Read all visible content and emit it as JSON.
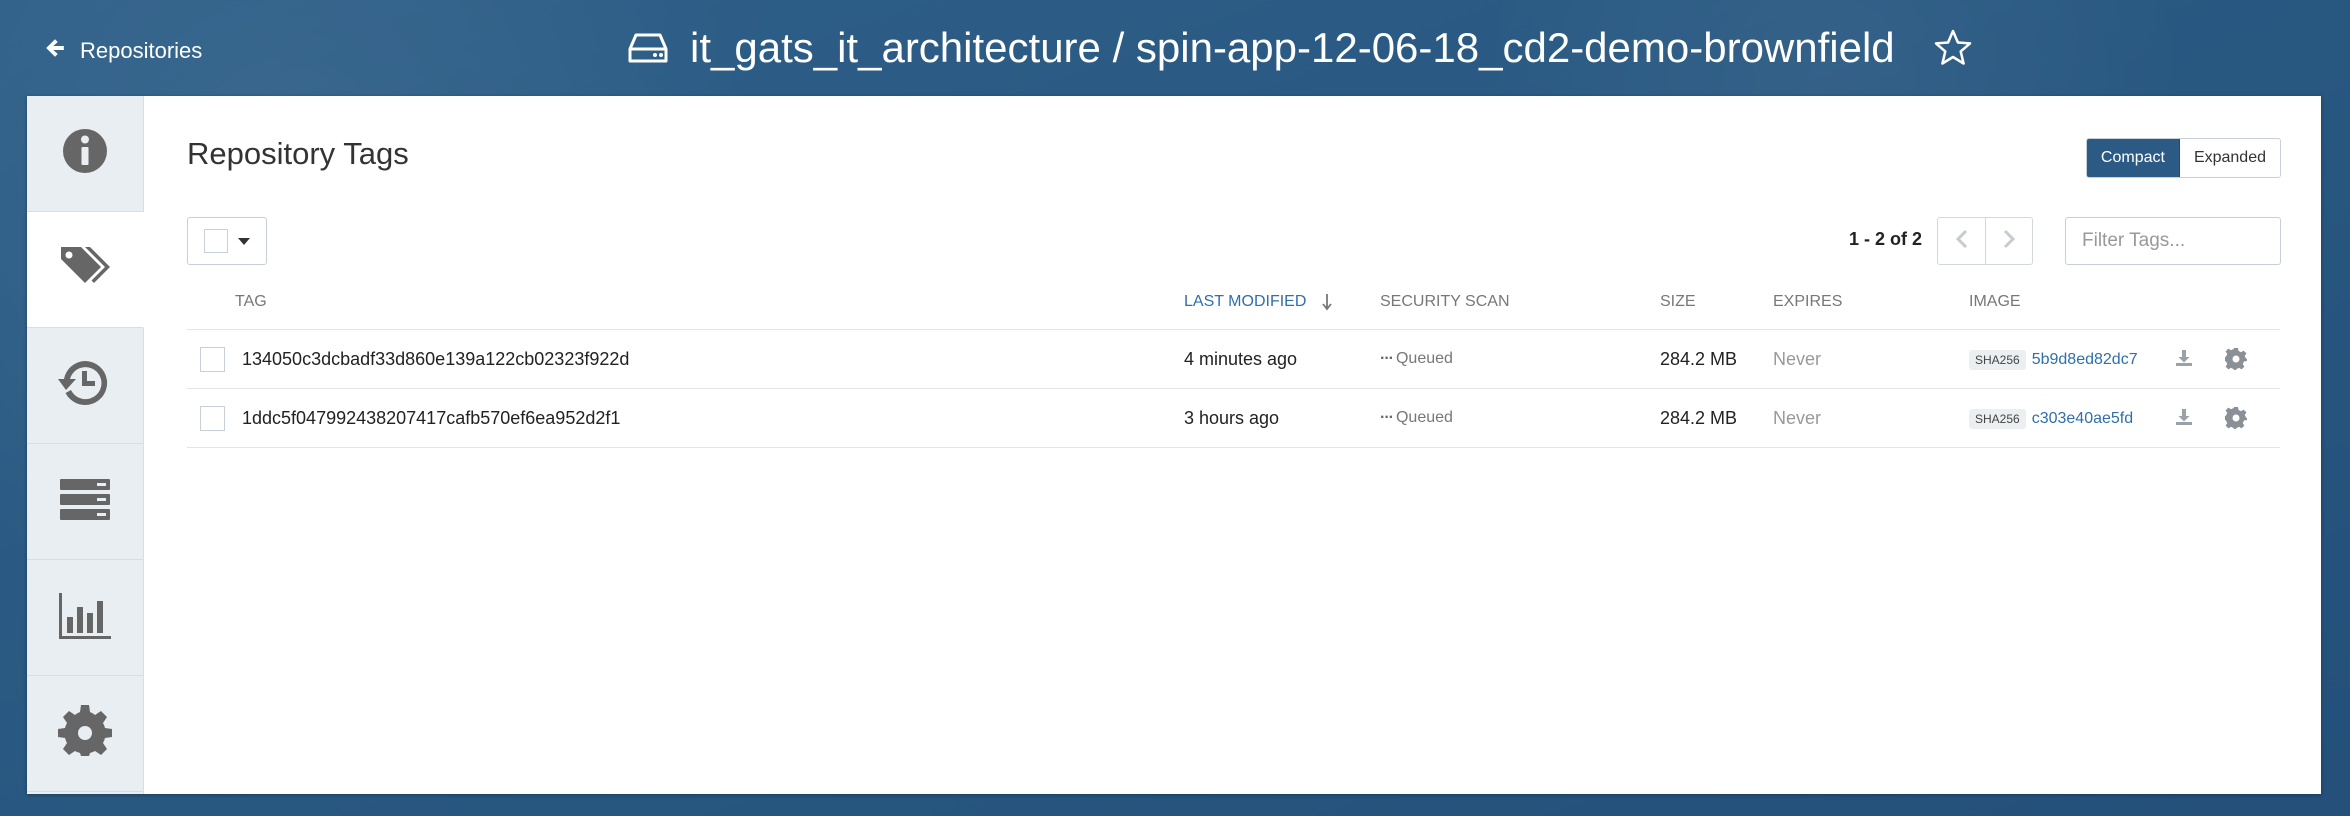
{
  "header": {
    "back_label": "Repositories",
    "repo_title": "it_gats_it_architecture / spin-app-12-06-18_cd2-demo-brownfield",
    "icons": {
      "back": "arrow-left-icon",
      "repo": "hard-drive-icon",
      "star": "star-outline-icon"
    }
  },
  "sidebar": {
    "items": [
      {
        "name": "info",
        "icon": "info-circle-icon",
        "active": false
      },
      {
        "name": "tags",
        "icon": "tags-icon",
        "active": true
      },
      {
        "name": "history",
        "icon": "history-icon",
        "active": false
      },
      {
        "name": "builds",
        "icon": "server-stack-icon",
        "active": false
      },
      {
        "name": "usage",
        "icon": "bar-chart-icon",
        "active": false
      },
      {
        "name": "settings",
        "icon": "gear-icon",
        "active": false
      }
    ]
  },
  "main": {
    "title": "Repository Tags",
    "view_toggle": {
      "compact": "Compact",
      "expanded": "Expanded",
      "selected": "Compact"
    },
    "pagination": {
      "text": "1 - 2 of 2"
    },
    "filter": {
      "placeholder": "Filter Tags..."
    },
    "table": {
      "headers": {
        "tag": "TAG",
        "last_modified": "LAST MODIFIED",
        "security_scan": "SECURITY SCAN",
        "size": "SIZE",
        "expires": "EXPIRES",
        "image": "IMAGE"
      },
      "sort": {
        "column": "last_modified",
        "direction": "descending"
      },
      "rows": [
        {
          "tag": "134050c3dcbadf33d860e139a122cb02323f922d",
          "last_modified": "4 minutes ago",
          "security_scan": "Queued",
          "size": "284.2 MB",
          "expires": "Never",
          "image_algo": "SHA256",
          "image_digest": "5b9d8ed82dc7"
        },
        {
          "tag": "1ddc5f047992438207417cafb570ef6ea952d2f1",
          "last_modified": "3 hours ago",
          "security_scan": "Queued",
          "size": "284.2 MB",
          "expires": "Never",
          "image_algo": "SHA256",
          "image_digest": "c303e40ae5fd"
        }
      ]
    }
  },
  "colors": {
    "header_bg": "#2d5a84",
    "accent": "#2b5a85",
    "link": "#2f6fab",
    "muted": "#999999"
  }
}
